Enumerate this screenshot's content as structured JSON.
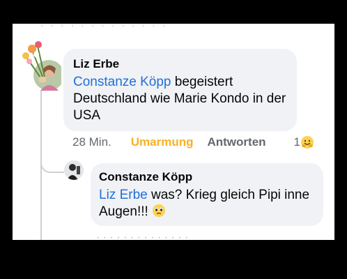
{
  "comment": {
    "author": "Liz Erbe",
    "mention": "Constanze Köpp",
    "text": " begeistert Deutschland wie Marie Kondo in der USA",
    "time": "28 Min.",
    "reaction_label": "Umarmung",
    "reply_label": "Antworten",
    "reaction_count": "1",
    "reaction_emoji": "hug-emoji"
  },
  "reply": {
    "author": "Constanze Köpp",
    "mention": "Liz Erbe",
    "text": " was? Krieg gleich Pipi inne Augen!!! ",
    "emoji": "pleading-face-emoji"
  },
  "colors": {
    "mention": "#216fdb",
    "reaction": "#f7b125",
    "bubble": "#f0f2f5",
    "meta": "#65676b"
  }
}
